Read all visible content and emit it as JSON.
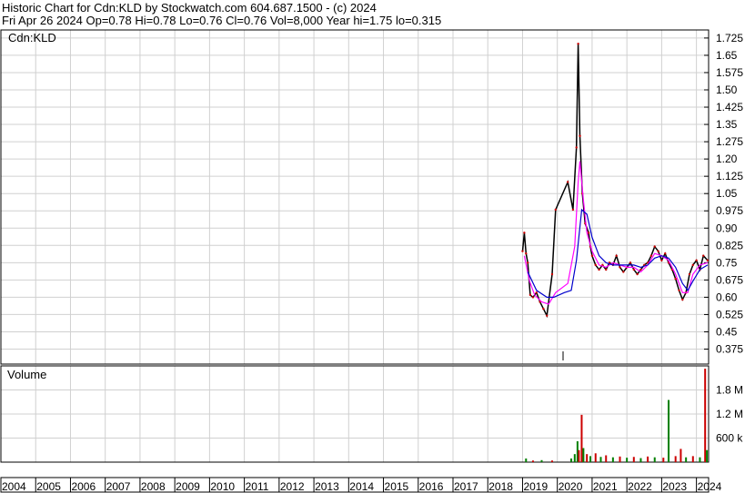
{
  "header": {
    "line1": "Historic Chart for Cdn:KLD by Stockwatch.com 604.687.1500 - (c) 2024",
    "line2": "Fri Apr 26 2024   Op=0.78  Hi=0.78  Lo=0.76  Cl=0.76  Vol=8,000   Year hi=1.75  lo=0.315"
  },
  "price_panel": {
    "label": "Cdn:KLD"
  },
  "volume_panel": {
    "label": "Volume"
  },
  "chart_data": {
    "type": "line",
    "title": "Historic Chart for Cdn:KLD by Stockwatch.com 604.687.1500 - (c) 2024",
    "x_axis": {
      "tick_labels": [
        "2004",
        "2005",
        "2006",
        "2007",
        "2008",
        "2009",
        "2010",
        "2011",
        "2012",
        "2013",
        "2014",
        "2015",
        "2016",
        "2017",
        "2018",
        "2019",
        "2020",
        "2021",
        "2022",
        "2023",
        "2024"
      ],
      "range": [
        2004.0,
        2024.35
      ]
    },
    "price_axis": {
      "tick_labels": [
        "1.725",
        "1.65",
        "1.575",
        "1.50",
        "1.425",
        "1.35",
        "1.275",
        "1.20",
        "1.125",
        "1.05",
        "0.975",
        "0.90",
        "0.825",
        "0.75",
        "0.675",
        "0.60",
        "0.525",
        "0.45",
        "0.375"
      ],
      "ylim": [
        0.31,
        1.76
      ],
      "grid": true
    },
    "volume_axis": {
      "tick_labels": [
        "1.8 M",
        "1.2 M",
        "600 k"
      ],
      "ylim": [
        0,
        2400000
      ]
    },
    "series": [
      {
        "name": "price",
        "color": "#000000",
        "points": [
          [
            2019.0,
            0.8
          ],
          [
            2019.05,
            0.88
          ],
          [
            2019.1,
            0.79
          ],
          [
            2019.15,
            0.75
          ],
          [
            2019.22,
            0.61
          ],
          [
            2019.3,
            0.6
          ],
          [
            2019.4,
            0.62
          ],
          [
            2019.5,
            0.58
          ],
          [
            2019.6,
            0.55
          ],
          [
            2019.7,
            0.52
          ],
          [
            2019.85,
            0.7
          ],
          [
            2019.95,
            0.98
          ],
          [
            2020.3,
            1.1
          ],
          [
            2020.45,
            0.98
          ],
          [
            2020.55,
            1.25
          ],
          [
            2020.6,
            1.7
          ],
          [
            2020.65,
            1.3
          ],
          [
            2020.72,
            1.05
          ],
          [
            2020.8,
            0.92
          ],
          [
            2020.9,
            0.88
          ],
          [
            2020.95,
            0.82
          ],
          [
            2021.0,
            0.78
          ],
          [
            2021.1,
            0.74
          ],
          [
            2021.2,
            0.72
          ],
          [
            2021.3,
            0.74
          ],
          [
            2021.4,
            0.72
          ],
          [
            2021.5,
            0.75
          ],
          [
            2021.6,
            0.74
          ],
          [
            2021.7,
            0.78
          ],
          [
            2021.8,
            0.73
          ],
          [
            2021.9,
            0.71
          ],
          [
            2022.0,
            0.73
          ],
          [
            2022.1,
            0.75
          ],
          [
            2022.2,
            0.72
          ],
          [
            2022.3,
            0.7
          ],
          [
            2022.4,
            0.72
          ],
          [
            2022.5,
            0.74
          ],
          [
            2022.6,
            0.75
          ],
          [
            2022.7,
            0.78
          ],
          [
            2022.8,
            0.82
          ],
          [
            2022.9,
            0.8
          ],
          [
            2023.0,
            0.76
          ],
          [
            2023.1,
            0.79
          ],
          [
            2023.2,
            0.75
          ],
          [
            2023.3,
            0.72
          ],
          [
            2023.4,
            0.68
          ],
          [
            2023.5,
            0.63
          ],
          [
            2023.6,
            0.59
          ],
          [
            2023.7,
            0.62
          ],
          [
            2023.8,
            0.7
          ],
          [
            2023.9,
            0.74
          ],
          [
            2024.0,
            0.76
          ],
          [
            2024.1,
            0.72
          ],
          [
            2024.2,
            0.78
          ],
          [
            2024.32,
            0.76
          ]
        ]
      },
      {
        "name": "ma-short",
        "color": "#ff00ff",
        "points": [
          [
            2019.05,
            0.78
          ],
          [
            2019.2,
            0.67
          ],
          [
            2019.35,
            0.61
          ],
          [
            2019.55,
            0.58
          ],
          [
            2019.75,
            0.57
          ],
          [
            2019.95,
            0.62
          ],
          [
            2020.3,
            0.66
          ],
          [
            2020.5,
            0.82
          ],
          [
            2020.6,
            1.1
          ],
          [
            2020.65,
            1.19
          ],
          [
            2020.75,
            1.02
          ],
          [
            2020.85,
            0.88
          ],
          [
            2021.0,
            0.8
          ],
          [
            2021.2,
            0.74
          ],
          [
            2021.4,
            0.73
          ],
          [
            2021.6,
            0.75
          ],
          [
            2021.8,
            0.74
          ],
          [
            2022.0,
            0.73
          ],
          [
            2022.2,
            0.73
          ],
          [
            2022.4,
            0.71
          ],
          [
            2022.6,
            0.74
          ],
          [
            2022.8,
            0.79
          ],
          [
            2023.0,
            0.78
          ],
          [
            2023.2,
            0.76
          ],
          [
            2023.4,
            0.7
          ],
          [
            2023.6,
            0.62
          ],
          [
            2023.75,
            0.62
          ],
          [
            2023.9,
            0.7
          ],
          [
            2024.1,
            0.74
          ],
          [
            2024.32,
            0.75
          ]
        ]
      },
      {
        "name": "ma-long",
        "color": "#0000cc",
        "points": [
          [
            2019.15,
            0.71
          ],
          [
            2019.4,
            0.63
          ],
          [
            2019.7,
            0.6
          ],
          [
            2019.9,
            0.6
          ],
          [
            2020.2,
            0.62
          ],
          [
            2020.4,
            0.63
          ],
          [
            2020.55,
            0.76
          ],
          [
            2020.7,
            0.98
          ],
          [
            2020.85,
            0.96
          ],
          [
            2021.0,
            0.86
          ],
          [
            2021.2,
            0.78
          ],
          [
            2021.4,
            0.75
          ],
          [
            2021.6,
            0.74
          ],
          [
            2021.8,
            0.74
          ],
          [
            2022.0,
            0.74
          ],
          [
            2022.2,
            0.74
          ],
          [
            2022.4,
            0.73
          ],
          [
            2022.6,
            0.74
          ],
          [
            2022.8,
            0.77
          ],
          [
            2023.0,
            0.78
          ],
          [
            2023.2,
            0.77
          ],
          [
            2023.4,
            0.73
          ],
          [
            2023.6,
            0.66
          ],
          [
            2023.75,
            0.63
          ],
          [
            2023.9,
            0.67
          ],
          [
            2024.1,
            0.72
          ],
          [
            2024.32,
            0.74
          ]
        ]
      }
    ],
    "volume_bars": [
      {
        "x": 2019.1,
        "v": 90000,
        "color": "#008000"
      },
      {
        "x": 2019.3,
        "v": 40000,
        "color": "#cc0000"
      },
      {
        "x": 2019.55,
        "v": 50000,
        "color": "#008000"
      },
      {
        "x": 2019.85,
        "v": 40000,
        "color": "#cc0000"
      },
      {
        "x": 2020.4,
        "v": 90000,
        "color": "#008000"
      },
      {
        "x": 2020.5,
        "v": 200000,
        "color": "#008000"
      },
      {
        "x": 2020.58,
        "v": 520000,
        "color": "#008000"
      },
      {
        "x": 2020.62,
        "v": 300000,
        "color": "#cc0000"
      },
      {
        "x": 2020.7,
        "v": 1180000,
        "color": "#cc0000"
      },
      {
        "x": 2020.75,
        "v": 350000,
        "color": "#008000"
      },
      {
        "x": 2020.85,
        "v": 200000,
        "color": "#cc0000"
      },
      {
        "x": 2020.95,
        "v": 150000,
        "color": "#008000"
      },
      {
        "x": 2021.1,
        "v": 220000,
        "color": "#cc0000"
      },
      {
        "x": 2021.25,
        "v": 130000,
        "color": "#008000"
      },
      {
        "x": 2021.4,
        "v": 170000,
        "color": "#cc0000"
      },
      {
        "x": 2021.6,
        "v": 120000,
        "color": "#008000"
      },
      {
        "x": 2021.8,
        "v": 140000,
        "color": "#cc0000"
      },
      {
        "x": 2022.0,
        "v": 110000,
        "color": "#008000"
      },
      {
        "x": 2022.2,
        "v": 130000,
        "color": "#cc0000"
      },
      {
        "x": 2022.4,
        "v": 100000,
        "color": "#008000"
      },
      {
        "x": 2022.6,
        "v": 140000,
        "color": "#cc0000"
      },
      {
        "x": 2022.8,
        "v": 120000,
        "color": "#008000"
      },
      {
        "x": 2023.05,
        "v": 110000,
        "color": "#cc0000"
      },
      {
        "x": 2023.2,
        "v": 1550000,
        "color": "#008000"
      },
      {
        "x": 2023.4,
        "v": 150000,
        "color": "#cc0000"
      },
      {
        "x": 2023.55,
        "v": 330000,
        "color": "#cc0000"
      },
      {
        "x": 2023.7,
        "v": 120000,
        "color": "#008000"
      },
      {
        "x": 2023.9,
        "v": 150000,
        "color": "#cc0000"
      },
      {
        "x": 2024.1,
        "v": 120000,
        "color": "#008000"
      },
      {
        "x": 2024.25,
        "v": 2330000,
        "color": "#cc0000"
      },
      {
        "x": 2024.3,
        "v": 300000,
        "color": "#008000"
      }
    ]
  }
}
